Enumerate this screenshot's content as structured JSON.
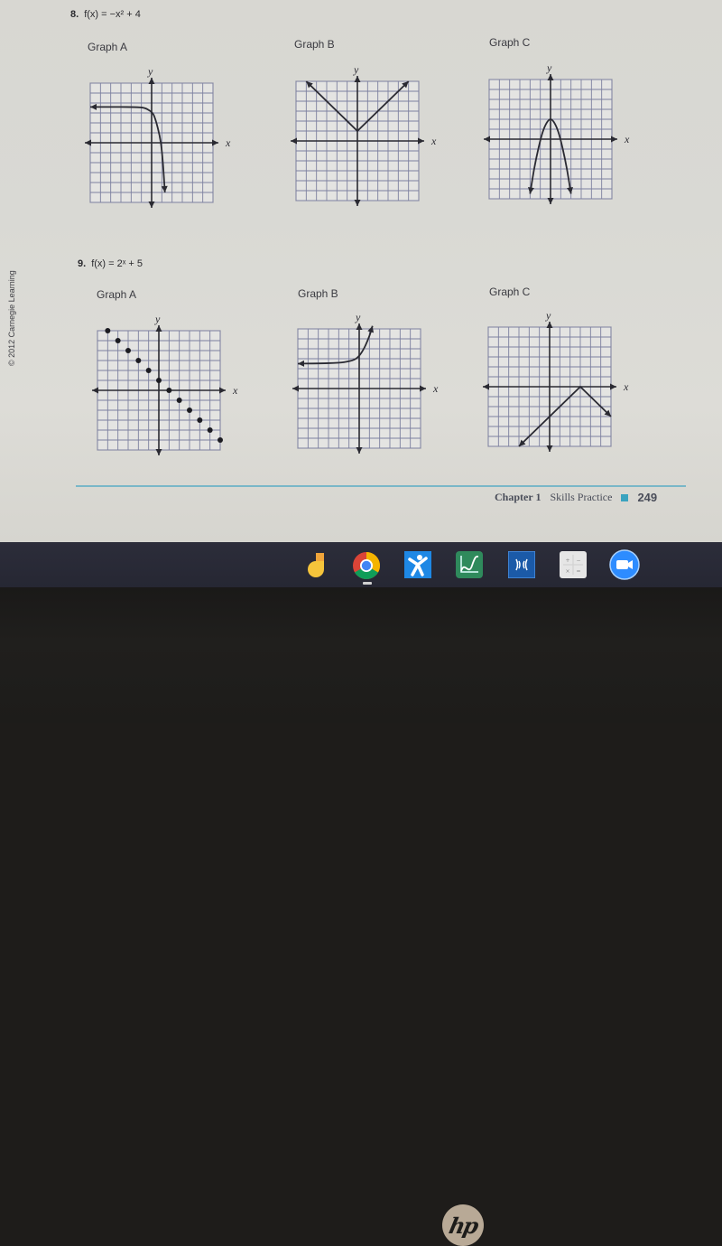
{
  "page": {
    "copyright": "© 2012 Carnegie Learning",
    "footer": {
      "chapter": "Chapter 1",
      "section": "Skills Practice",
      "page_number": "249"
    }
  },
  "problems": [
    {
      "number": "8.",
      "function": "f(x) = −x² + 4",
      "graphs": [
        {
          "label": "Graph A",
          "axis_x": "x",
          "axis_y": "y",
          "type": "curve",
          "description": "horizontal asymptote near y = 4 on the left, drops steeply downward right of the y-axis",
          "points": [
            [
              -6,
              3.6
            ],
            [
              -3,
              3.6
            ],
            [
              -1,
              3.55
            ],
            [
              -0.3,
              3.3
            ],
            [
              0.2,
              2.8
            ],
            [
              0.6,
              1.5
            ],
            [
              0.9,
              0
            ],
            [
              1.1,
              -2
            ],
            [
              1.3,
              -5
            ]
          ],
          "arrows": [
            "start",
            "end"
          ]
        },
        {
          "label": "Graph B",
          "axis_x": "x",
          "axis_y": "y",
          "type": "polyline",
          "description": "V shape with vertex at (0, 1)",
          "points": [
            [
              -5,
              6
            ],
            [
              0,
              1
            ],
            [
              5,
              6
            ]
          ],
          "arrows": [
            "start",
            "end"
          ]
        },
        {
          "label": "Graph C",
          "axis_x": "x",
          "axis_y": "y",
          "type": "curve",
          "description": "downward parabola with vertex near (0, 2)",
          "points": [
            [
              -2,
              -5.5
            ],
            [
              -1.6,
              -3
            ],
            [
              -1.2,
              -1
            ],
            [
              -0.8,
              0.6
            ],
            [
              -0.4,
              1.6
            ],
            [
              0,
              2
            ],
            [
              0.4,
              1.6
            ],
            [
              0.8,
              0.6
            ],
            [
              1.2,
              -1
            ],
            [
              1.6,
              -3
            ],
            [
              2,
              -5.5
            ]
          ],
          "arrows": [
            "start",
            "end"
          ]
        }
      ]
    },
    {
      "number": "9.",
      "function": "f(x) = 2ˣ + 5",
      "graphs": [
        {
          "label": "Graph A",
          "axis_x": "x",
          "axis_y": "y",
          "type": "scatter",
          "description": "discrete points descending along a line with slope −1",
          "points": [
            [
              -5,
              6
            ],
            [
              -4,
              5
            ],
            [
              -3,
              4
            ],
            [
              -2,
              3
            ],
            [
              -1,
              2
            ],
            [
              0,
              1
            ],
            [
              1,
              0
            ],
            [
              2,
              -1
            ],
            [
              3,
              -2
            ],
            [
              4,
              -3
            ],
            [
              5,
              -4
            ],
            [
              6,
              -5
            ]
          ],
          "arrows": []
        },
        {
          "label": "Graph B",
          "axis_x": "x",
          "axis_y": "y",
          "type": "curve",
          "description": "exponential growth with horizontal asymptote near y = 2.5",
          "points": [
            [
              -6,
              2.5
            ],
            [
              -3,
              2.55
            ],
            [
              -1.5,
              2.65
            ],
            [
              -0.5,
              2.9
            ],
            [
              0,
              3.3
            ],
            [
              0.5,
              4.1
            ],
            [
              1,
              5.3
            ],
            [
              1.3,
              6.3
            ]
          ],
          "arrows": [
            "start",
            "end"
          ]
        },
        {
          "label": "Graph C",
          "axis_x": "x",
          "axis_y": "y",
          "type": "polyline",
          "description": "inverted V with vertex at (3, 0)",
          "points": [
            [
              -3,
              -6
            ],
            [
              3,
              0
            ],
            [
              6,
              -3
            ]
          ],
          "arrows": [
            "start",
            "end"
          ]
        }
      ]
    }
  ],
  "grid": {
    "x_range": [
      -6,
      6
    ],
    "y_range": [
      -6,
      6
    ]
  },
  "taskbar": {
    "apps": [
      {
        "name": "Google Keep",
        "icon": "keep-icon",
        "color": "#f3c13a"
      },
      {
        "name": "Google Chrome",
        "icon": "chrome-icon",
        "color": "#4285f4",
        "active": true
      },
      {
        "name": "Explain Everything",
        "icon": "explain-everything-icon",
        "color": "#1a7fd6"
      },
      {
        "name": "Desmos",
        "icon": "desmos-icon",
        "color": "#2f8a5c"
      },
      {
        "name": "Read&Write",
        "icon": "readwrite-icon",
        "color": "#1b5aa8"
      },
      {
        "name": "Calculator",
        "icon": "calculator-icon",
        "color": "#e8e8e8"
      },
      {
        "name": "Zoom",
        "icon": "zoom-icon",
        "color": "#2d8cff"
      }
    ]
  },
  "device": {
    "brand": "hp"
  }
}
